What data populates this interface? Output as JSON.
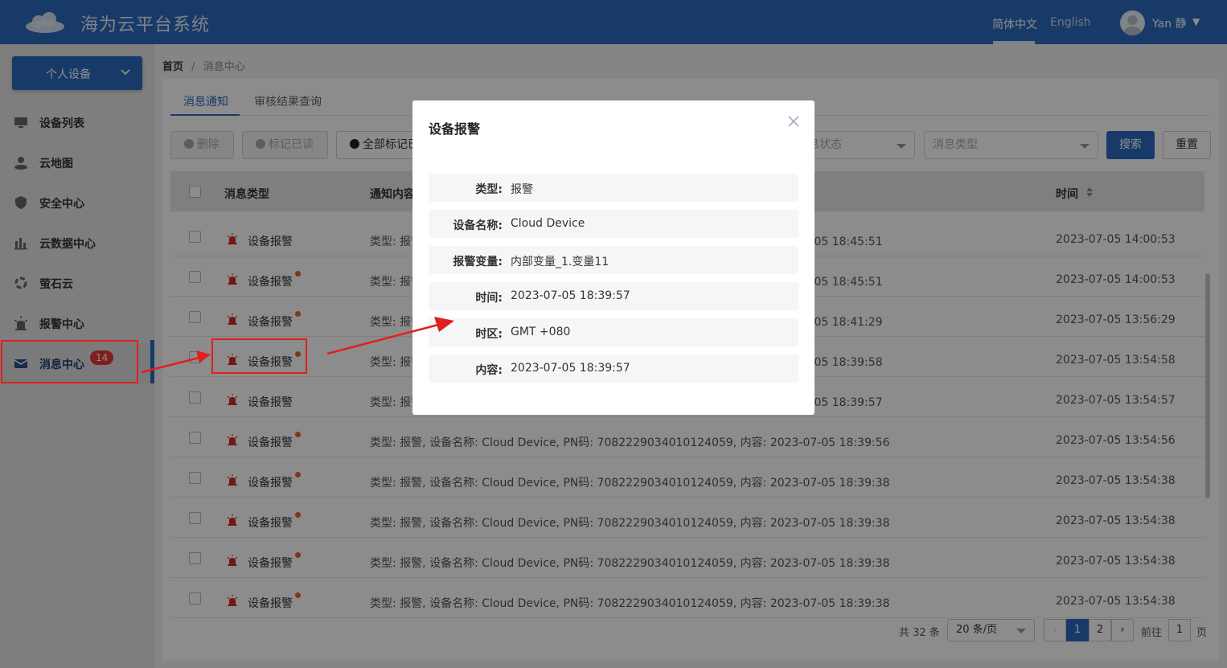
{
  "header": {
    "app_title": "海为云平台系统",
    "lang_zh": "简体中文",
    "lang_en": "English",
    "user_name": "Yan 静"
  },
  "sidebar": {
    "device_select": "个人设备",
    "items": [
      {
        "label": "设备列表",
        "icon": "monitor-icon"
      },
      {
        "label": "云地图",
        "icon": "map-pin-icon"
      },
      {
        "label": "安全中心",
        "icon": "shield-icon"
      },
      {
        "label": "云数据中心",
        "icon": "bar-chart-icon"
      },
      {
        "label": "萤石云",
        "icon": "cloud-sync-icon"
      },
      {
        "label": "报警中心",
        "icon": "alarm-light-icon"
      },
      {
        "label": "消息中心",
        "icon": "envelope-icon",
        "badge": "14"
      }
    ]
  },
  "breadcrumb": {
    "home": "首页",
    "sep": "/",
    "current": "消息中心"
  },
  "tabs": [
    "消息通知",
    "审核结果查询"
  ],
  "toolbar": {
    "delete": "删除",
    "mark_read": "标记已读",
    "mark_all": "全部标记已读",
    "status_placeholder": "消息状态",
    "type_placeholder": "消息类型",
    "search": "搜索",
    "reset": "重置"
  },
  "table": {
    "headers": {
      "type": "消息类型",
      "content": "通知内容",
      "time": "时间"
    },
    "rows": [
      {
        "type": "设备报警",
        "unread": false,
        "content": "类型: 报警, 设备名称: Cloud Device, PN码: 708222903401012405, 内容: 2023-07-05 18:45:51",
        "time": "2023-07-05 14:00:53"
      },
      {
        "type": "设备报警",
        "unread": true,
        "content": "类型: 报警, 设备名称: Cloud Device, PN码: 708222903401012405, 内容: 2023-07-05 18:45:51",
        "time": "2023-07-05 14:00:53"
      },
      {
        "type": "设备报警",
        "unread": true,
        "content": "类型: 报警, 设备名称: Cloud Device, PN码: 708222903401012405, 内容: 2023-07-05 18:41:29",
        "time": "2023-07-05 13:56:29"
      },
      {
        "type": "设备报警",
        "unread": true,
        "content": "类型: 报警, 设备名称: Cloud Device, PN码: 708222903401012405, 内容: 2023-07-05 18:39:58",
        "time": "2023-07-05 13:54:58"
      },
      {
        "type": "设备报警",
        "unread": false,
        "content": "类型: 报警, 设备名称: Cloud Device, PN码: 708222903401012405, 内容: 2023-07-05 18:39:57",
        "time": "2023-07-05 13:54:57"
      },
      {
        "type": "设备报警",
        "unread": true,
        "content": "类型: 报警, 设备名称: Cloud Device, PN码: 7082229034010124059, 内容: 2023-07-05 18:39:56",
        "time": "2023-07-05 13:54:56"
      },
      {
        "type": "设备报警",
        "unread": true,
        "content": "类型: 报警, 设备名称: Cloud Device, PN码: 7082229034010124059, 内容: 2023-07-05 18:39:38",
        "time": "2023-07-05 13:54:38"
      },
      {
        "type": "设备报警",
        "unread": true,
        "content": "类型: 报警, 设备名称: Cloud Device, PN码: 7082229034010124059, 内容: 2023-07-05 18:39:38",
        "time": "2023-07-05 13:54:38"
      },
      {
        "type": "设备报警",
        "unread": true,
        "content": "类型: 报警, 设备名称: Cloud Device, PN码: 7082229034010124059, 内容: 2023-07-05 18:39:38",
        "time": "2023-07-05 13:54:38"
      },
      {
        "type": "设备报警",
        "unread": true,
        "content": "类型: 报警, 设备名称: Cloud Device, PN码: 7082229034010124059, 内容: 2023-07-05 18:39:38",
        "time": "2023-07-05 13:54:38"
      }
    ]
  },
  "pagination": {
    "total": "共 32 条",
    "page_size": "20 条/页",
    "pages": [
      "1",
      "2"
    ],
    "goto_label": "前往",
    "goto_value": "1",
    "page_suffix": "页"
  },
  "modal": {
    "title": "设备报警",
    "fields": [
      {
        "key": "类型:",
        "value": "报警"
      },
      {
        "key": "设备名称:",
        "value": "Cloud Device"
      },
      {
        "key": "报警变量:",
        "value": "内部变量_1.变量11"
      },
      {
        "key": "时间:",
        "value": "2023-07-05 18:39:57"
      },
      {
        "key": "时区:",
        "value": "GMT +080"
      },
      {
        "key": "内容:",
        "value": "2023-07-05 18:39:57"
      }
    ]
  },
  "colors": {
    "primary": "#2d6bbf",
    "badge": "#e53935",
    "unread_dot": "#e3642c",
    "annotation": "#e02020"
  }
}
